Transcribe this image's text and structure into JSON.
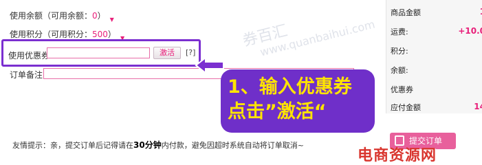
{
  "form": {
    "balance_label": "使用余额（可用余额：",
    "balance_value": "0",
    "balance_close": "）",
    "points_label": "使用积分（可用积分：",
    "points_value": "500",
    "points_close": "）",
    "coupon_label": "使用优惠券",
    "coupon_value": "",
    "activate_label": "激活",
    "help_label": "[?]",
    "note_label": "订单备注",
    "note_value": ""
  },
  "callout": {
    "line1": "1、输入优惠券",
    "line2": "点击”激活“"
  },
  "watermark": {
    "cn": "券百汇",
    "url": "www.quanbaihui.com"
  },
  "summary": {
    "rows": [
      {
        "label": "商品金额",
        "value": "1"
      },
      {
        "label": "运费:",
        "value": "+10.0"
      },
      {
        "label": "积分:",
        "value": ""
      },
      {
        "label": "余额:",
        "value": ""
      },
      {
        "label": "优惠券",
        "value": ""
      },
      {
        "label": "应付金额",
        "value": "14"
      }
    ]
  },
  "tip": {
    "prefix": "友情提示：亲，提交订单后记得请在",
    "emphasis": "30分钟",
    "suffix": "内付款，避免因超时系统自动将订单取消~"
  },
  "submit_label": "提交订单",
  "site_logo": "电商资源网",
  "colors": {
    "accent": "#e8207a",
    "callout_bg": "#6f2fc9",
    "callout_text": "#ffe400",
    "submit_bg": "#e8609c"
  }
}
